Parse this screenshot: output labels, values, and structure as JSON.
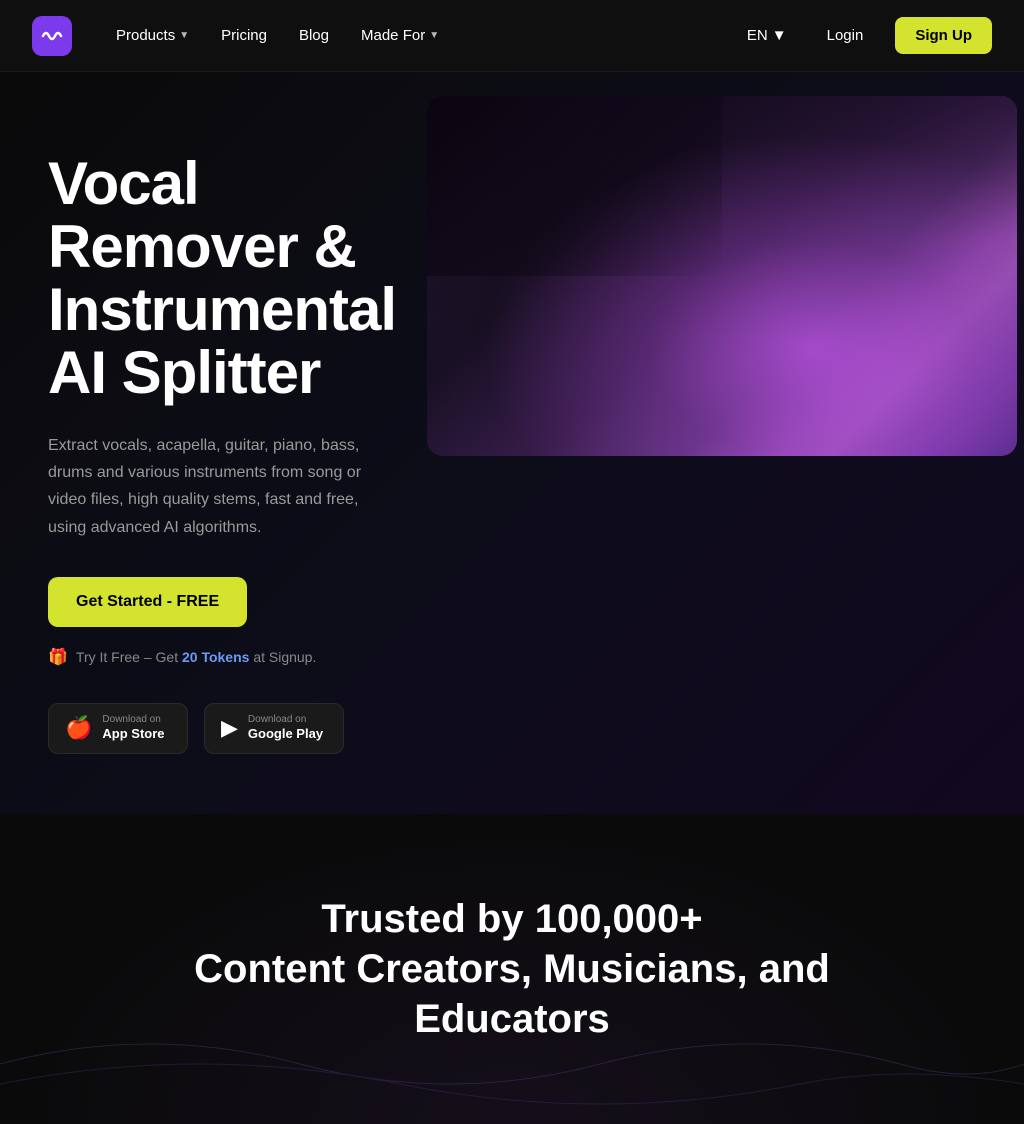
{
  "nav": {
    "logo_label": "Lalal AI Logo",
    "items": [
      {
        "label": "Products",
        "has_dropdown": true
      },
      {
        "label": "Pricing",
        "has_dropdown": false
      },
      {
        "label": "Blog",
        "has_dropdown": false
      },
      {
        "label": "Made For",
        "has_dropdown": true
      }
    ],
    "lang": "EN",
    "login_label": "Login",
    "signup_label": "Sign Up"
  },
  "hero": {
    "title": "Vocal Remover & Instrumental AI Splitter",
    "description": "Extract vocals, acapella, guitar, piano, bass, drums and various instruments from song or video files, high quality stems, fast and free, using advanced AI algorithms.",
    "cta_label": "Get Started - FREE",
    "free_trial_prefix": "Try It Free – Get",
    "tokens_count": "20 Tokens",
    "free_trial_suffix": "at Signup.",
    "app_store": {
      "small_label": "Download on",
      "name_label": "App Store"
    },
    "google_play": {
      "small_label": "Download on",
      "name_label": "Google Play"
    }
  },
  "trusted": {
    "line1": "Trusted by 100,000+",
    "line2": "Content Creators, Musicians, and",
    "line3": "Educators"
  }
}
